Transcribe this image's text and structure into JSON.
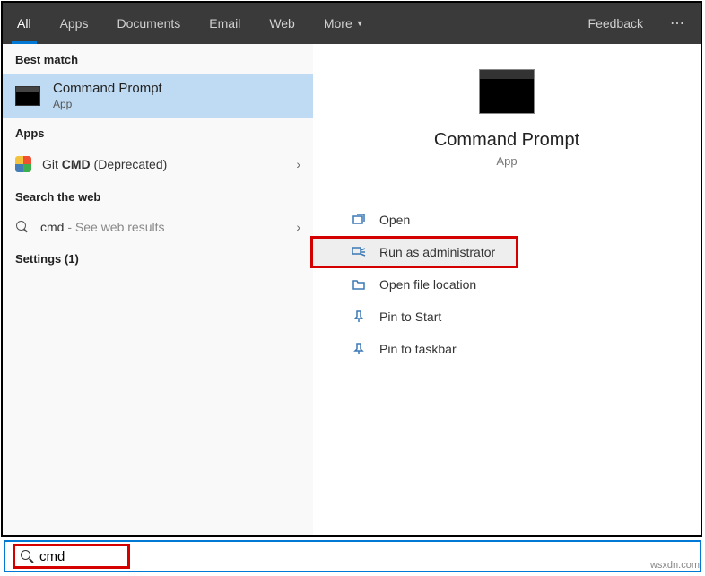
{
  "tabs": {
    "all": "All",
    "apps": "Apps",
    "documents": "Documents",
    "email": "Email",
    "web": "Web",
    "more": "More"
  },
  "header": {
    "feedback": "Feedback"
  },
  "left": {
    "best_match_h": "Best match",
    "best": {
      "title": "Command Prompt",
      "sub": "App"
    },
    "apps_h": "Apps",
    "git_prefix": "Git ",
    "git_bold": "CMD",
    "git_suffix": " (Deprecated)",
    "search_web_h": "Search the web",
    "web_query": "cmd",
    "web_hint": " - See web results",
    "settings_h": "Settings (1)"
  },
  "right": {
    "title": "Command Prompt",
    "sub": "App",
    "actions": {
      "open": "Open",
      "runadmin": "Run as administrator",
      "openloc": "Open file location",
      "pinstart": "Pin to Start",
      "pintask": "Pin to taskbar"
    }
  },
  "search": {
    "value": "cmd"
  },
  "watermark": "wsxdn.com"
}
